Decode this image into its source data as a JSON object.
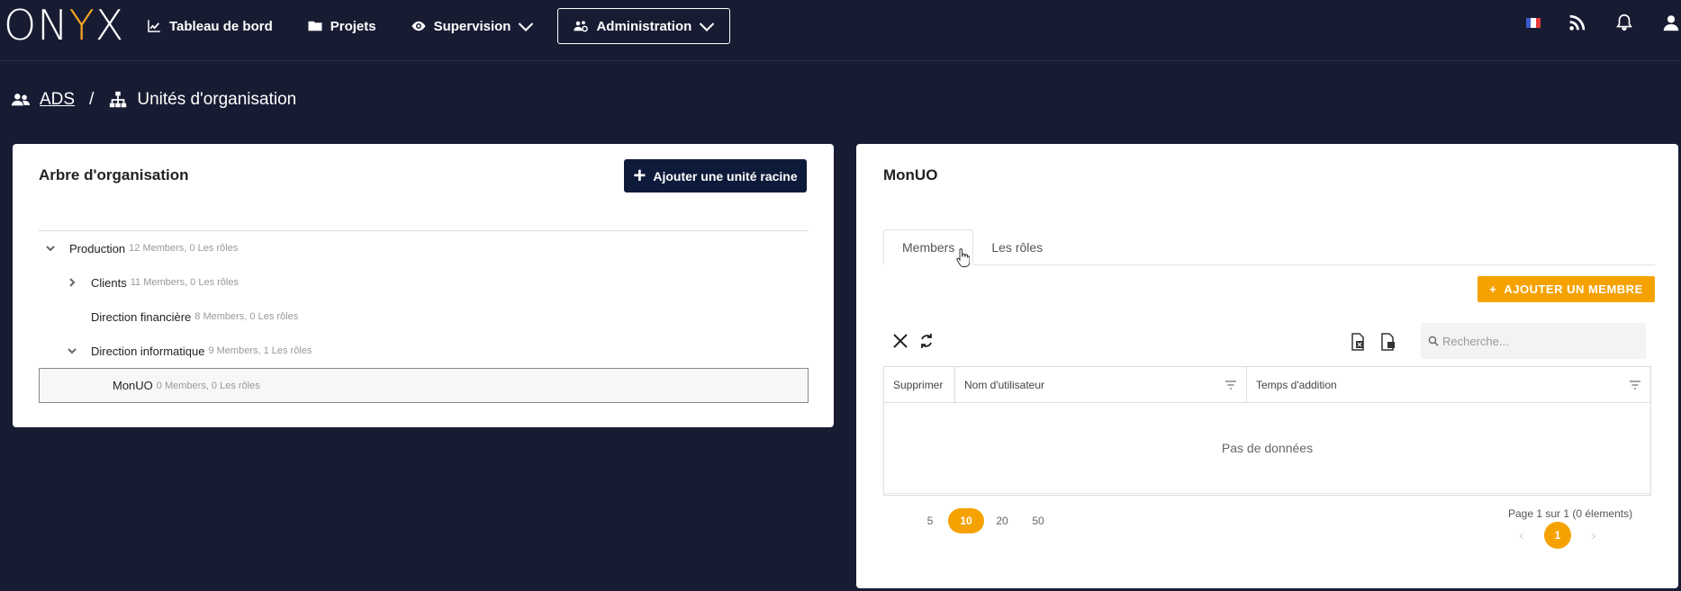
{
  "logo": {
    "left": "ON",
    "y": "Y",
    "right": "X"
  },
  "nav": {
    "items": [
      {
        "label": "Tableau de bord",
        "icon": "chart-line-icon"
      },
      {
        "label": "Projets",
        "icon": "folder-icon"
      },
      {
        "label": "Supervision",
        "icon": "eye-icon",
        "dropdown": true
      },
      {
        "label": "Administration",
        "icon": "users-cog-icon",
        "dropdown": true,
        "active": true
      }
    ]
  },
  "breadcrumb": {
    "root": "ADS",
    "separator": "/",
    "current": "Unités d'organisation"
  },
  "left_card": {
    "title": "Arbre d'organisation",
    "add_button": "Ajouter une unité racine",
    "tree": [
      {
        "name": "Production",
        "meta": "12 Members, 0 Les rôles",
        "level": 0,
        "expanded": true
      },
      {
        "name": "Clients",
        "meta": "11 Members, 0 Les rôles",
        "level": 1,
        "expanded": false
      },
      {
        "name": "Direction financière",
        "meta": "8 Members, 0 Les rôles",
        "level": 1,
        "leaf": true
      },
      {
        "name": "Direction informatique",
        "meta": "9 Members, 1 Les rôles",
        "level": 1,
        "expanded": true
      },
      {
        "name": "MonUO",
        "meta": "0 Members, 0 Les rôles",
        "level": 2,
        "leaf": true,
        "selected": true
      }
    ]
  },
  "right_card": {
    "title": "MonUO",
    "tabs": [
      "Members",
      "Les rôles"
    ],
    "active_tab": 0,
    "add_member_button": "AJOUTER UN MEMBRE",
    "search_placeholder": "Recherche...",
    "columns": [
      "Supprimer",
      "Nom d'utilisateur",
      "Temps d'addition"
    ],
    "no_data": "Pas de données",
    "page_sizes": [
      "5",
      "10",
      "20",
      "50"
    ],
    "active_page_size": "10",
    "page_info": "Page 1 sur 1 (0 élements)",
    "current_page": "1",
    "prev": "‹",
    "next": "›"
  },
  "colors": {
    "background": "#181c33",
    "accent": "#f5a200",
    "dark_button": "#0e1a3a"
  }
}
